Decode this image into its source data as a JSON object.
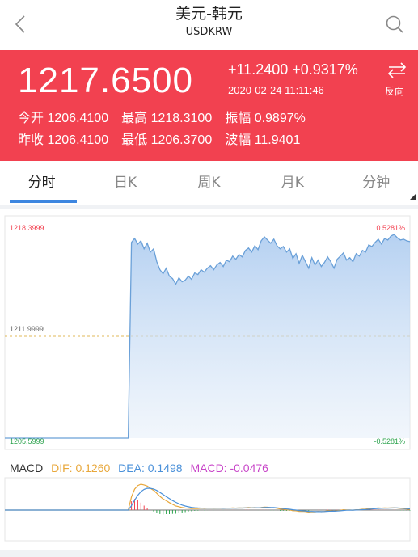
{
  "header": {
    "title": "美元-韩元",
    "subtitle": "USDKRW"
  },
  "quote": {
    "price": "1217.6500",
    "change": "+11.2400 +0.9317%",
    "time": "2020-02-24 11:11:46",
    "reverse_label": "反向",
    "stats_row1": [
      {
        "label": "今开",
        "value": "1206.4100"
      },
      {
        "label": "最高",
        "value": "1218.3100"
      },
      {
        "label": "振幅",
        "value": "0.9897%"
      }
    ],
    "stats_row2": [
      {
        "label": "昨收",
        "value": "1206.4100"
      },
      {
        "label": "最低",
        "value": "1206.3700"
      },
      {
        "label": "波幅",
        "value": "11.9401"
      }
    ]
  },
  "tabs": [
    {
      "label": "分时",
      "active": true
    },
    {
      "label": "日K",
      "active": false
    },
    {
      "label": "周K",
      "active": false
    },
    {
      "label": "月K",
      "active": false
    },
    {
      "label": "分钟",
      "active": false
    }
  ],
  "chart_labels": {
    "y_top": "1218.3999",
    "y_mid": "1211.9999",
    "y_bottom": "1205.5999",
    "pct_top": "0.5281%",
    "pct_bottom": "-0.5281%"
  },
  "macd": {
    "name": "MACD",
    "dif": "DIF: 0.1260",
    "dea": "DEA: 0.1498",
    "macd": "MACD: -0.0476"
  },
  "colors": {
    "up": "#f24150",
    "down": "#2aa24c",
    "line": "#6aa0d8",
    "dif": "#e8a73a",
    "dea": "#4a90d9",
    "macd": "#c845c8"
  },
  "chart_data": {
    "type": "area",
    "title": "",
    "ylim": [
      1205.5999,
      1218.3999
    ],
    "y_mid": 1211.9999,
    "values": [
      1205.6,
      1205.6,
      1205.6,
      1205.6,
      1205.6,
      1205.6,
      1205.6,
      1205.6,
      1205.6,
      1205.6,
      1205.6,
      1205.6,
      1205.6,
      1205.6,
      1205.6,
      1205.6,
      1205.6,
      1205.6,
      1205.6,
      1205.6,
      1205.6,
      1205.6,
      1205.6,
      1205.6,
      1205.6,
      1205.6,
      1205.6,
      1205.6,
      1205.6,
      1205.6,
      1205.6,
      1205.6,
      1205.6,
      1205.6,
      1205.6,
      1205.6,
      1205.6,
      1205.6,
      1205.6,
      1205.6,
      1217.8,
      1218.05,
      1217.7,
      1217.9,
      1217.4,
      1217.75,
      1217.2,
      1217.4,
      1216.6,
      1216.1,
      1215.85,
      1216.2,
      1215.7,
      1215.55,
      1215.2,
      1215.6,
      1215.35,
      1215.45,
      1215.7,
      1215.5,
      1215.9,
      1215.8,
      1216.1,
      1215.95,
      1216.2,
      1216.35,
      1216.1,
      1216.4,
      1216.55,
      1216.3,
      1216.7,
      1216.6,
      1216.95,
      1216.75,
      1217.05,
      1216.9,
      1217.3,
      1217.45,
      1217.2,
      1217.6,
      1217.35,
      1217.9,
      1218.15,
      1217.95,
      1217.75,
      1218.0,
      1217.6,
      1217.4,
      1217.55,
      1217.2,
      1217.4,
      1216.8,
      1217.1,
      1216.5,
      1217.0,
      1216.6,
      1216.2,
      1216.85,
      1216.4,
      1216.7,
      1216.3,
      1216.55,
      1216.9,
      1216.6,
      1216.2,
      1216.75,
      1216.95,
      1217.15,
      1216.7,
      1216.85,
      1216.6,
      1217.1,
      1216.95,
      1217.3,
      1217.2,
      1217.65,
      1217.55,
      1217.8,
      1218.0,
      1217.7,
      1218.05,
      1217.95,
      1218.2,
      1218.3,
      1218.1,
      1217.95,
      1218.0,
      1217.9,
      1217.85
    ]
  }
}
